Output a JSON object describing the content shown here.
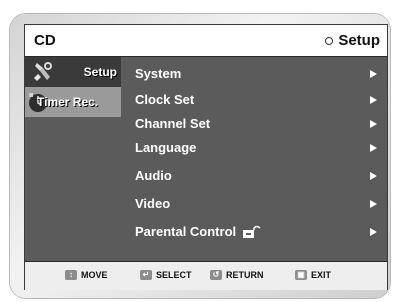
{
  "header": {
    "title": "CD",
    "mode_label": "Setup",
    "mode_icon": "circle-icon"
  },
  "sidebar": {
    "items": [
      {
        "label": "Setup",
        "icon": "gear-icon",
        "active": true
      },
      {
        "label": "Timer Rec.",
        "icon": "clock-icon",
        "active": false
      }
    ]
  },
  "menu": {
    "items": [
      {
        "label": "System"
      },
      {
        "label": "Clock Set"
      },
      {
        "label": "Channel Set"
      },
      {
        "label": "Language"
      },
      {
        "label": "Audio"
      },
      {
        "label": "Video"
      },
      {
        "label": "Parental Control",
        "icon": "lock-icon"
      }
    ]
  },
  "footer": {
    "hints": [
      {
        "label": "MOVE",
        "icon": "updown-icon"
      },
      {
        "label": "SELECT",
        "icon": "enter-icon"
      },
      {
        "label": "RETURN",
        "icon": "return-icon"
      },
      {
        "label": "EXIT",
        "icon": "exit-icon"
      }
    ]
  },
  "colors": {
    "screen_bg": "#5b5b5b",
    "active_tab": "#3a3a3a",
    "inactive_tab": "#9a9a9a",
    "text": "#ffffff"
  }
}
